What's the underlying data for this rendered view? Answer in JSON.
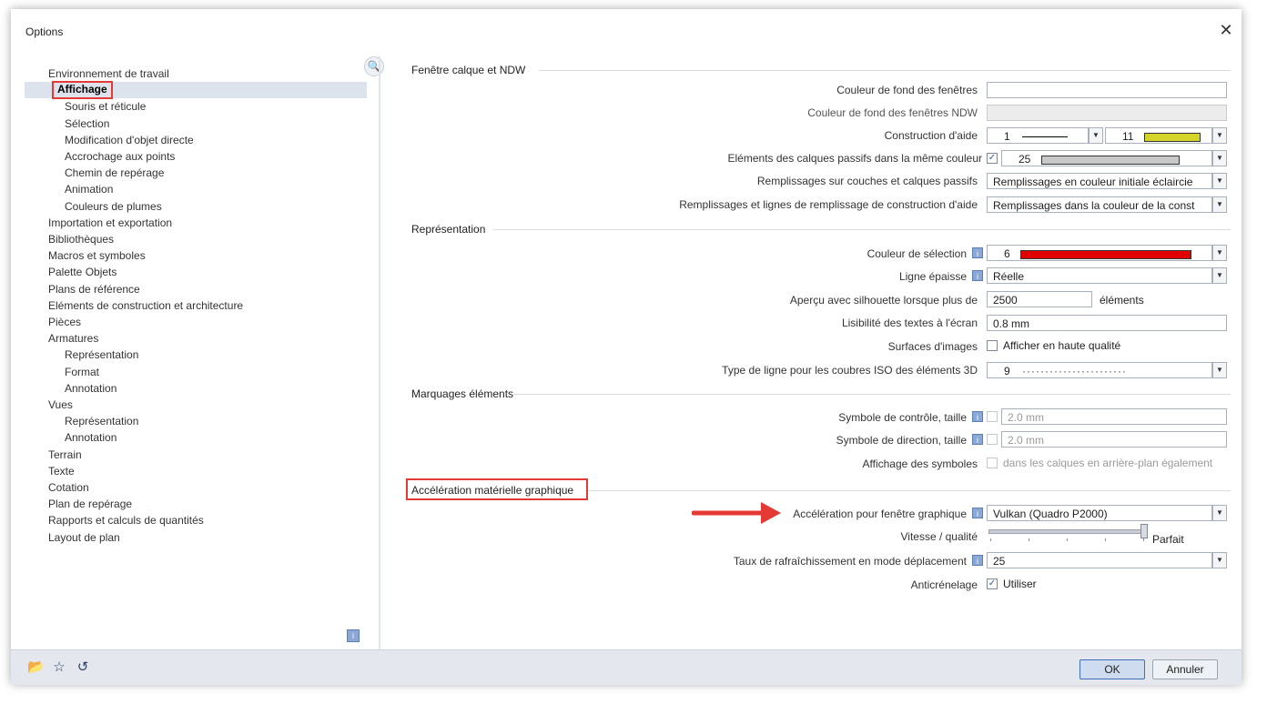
{
  "window": {
    "title": "Options",
    "close_symbol": "✕"
  },
  "tree": {
    "items": [
      {
        "label": "Environnement de travail",
        "level": 0
      },
      {
        "label": "Affichage",
        "level": 1,
        "selected": true
      },
      {
        "label": "Souris et réticule",
        "level": 1
      },
      {
        "label": "Sélection",
        "level": 1
      },
      {
        "label": "Modification d'objet directe",
        "level": 1
      },
      {
        "label": "Accrochage aux points",
        "level": 1
      },
      {
        "label": "Chemin de repérage",
        "level": 1
      },
      {
        "label": "Animation",
        "level": 1
      },
      {
        "label": "Couleurs de plumes",
        "level": 1
      },
      {
        "label": "Importation et exportation",
        "level": 0
      },
      {
        "label": "Bibliothèques",
        "level": 0
      },
      {
        "label": "Macros et symboles",
        "level": 0
      },
      {
        "label": "Palette Objets",
        "level": 0
      },
      {
        "label": "Plans de référence",
        "level": 0
      },
      {
        "label": "Eléments de construction et architecture",
        "level": 0
      },
      {
        "label": "Pièces",
        "level": 0
      },
      {
        "label": "Armatures",
        "level": 0
      },
      {
        "label": "Représentation",
        "level": 1
      },
      {
        "label": "Format",
        "level": 1
      },
      {
        "label": "Annotation",
        "level": 1
      },
      {
        "label": "Vues",
        "level": 0
      },
      {
        "label": "Représentation",
        "level": 1
      },
      {
        "label": "Annotation",
        "level": 1
      },
      {
        "label": "Terrain",
        "level": 0
      },
      {
        "label": "Texte",
        "level": 0
      },
      {
        "label": "Cotation",
        "level": 0
      },
      {
        "label": "Plan de repérage",
        "level": 0
      },
      {
        "label": "Rapports et calculs de quantités",
        "level": 0
      },
      {
        "label": "Layout de plan",
        "level": 0
      }
    ]
  },
  "sections": {
    "s1": "Fenêtre calque et NDW",
    "s2": "Représentation",
    "s3": "Marquages éléments",
    "s4": "Accélération matérielle graphique"
  },
  "rows": {
    "bg_color": {
      "label": "Couleur de fond des fenêtres"
    },
    "bg_color_ndw": {
      "label": "Couleur de fond des fenêtres NDW"
    },
    "construction": {
      "label": "Construction d'aide",
      "pen": "1",
      "color_num": "11",
      "color": "#d4d42a"
    },
    "passive_layers": {
      "label": "Eléments des calques passifs dans la même couleur",
      "color_num": "25",
      "color": "#c8c8c8"
    },
    "passive_fills": {
      "label": "Remplissages sur couches et calques passifs",
      "value": "Remplissages en couleur initiale éclaircie"
    },
    "aux_fills": {
      "label": "Remplissages et lignes de remplissage de construction d'aide",
      "value": "Remplissages dans la couleur de la const"
    },
    "sel_color": {
      "label": "Couleur de sélection",
      "color_num": "6",
      "color": "#e00000"
    },
    "thick_line": {
      "label": "Ligne épaisse",
      "value": "Réelle"
    },
    "silhouette": {
      "label": "Aperçu avec silhouette lorsque plus de",
      "value": "2500",
      "unit": "éléments"
    },
    "text_legibility": {
      "label": "Lisibilité des textes à l'écran",
      "value": "0.8 mm"
    },
    "image_surfaces": {
      "label": "Surfaces d'images",
      "check_label": "Afficher en haute qualité"
    },
    "iso_linetype": {
      "label": "Type de ligne pour les coubres ISO des éléments 3D",
      "value": "9",
      "dots": "·······················"
    },
    "ctrl_symbol": {
      "label": "Symbole de contrôle, taille",
      "value": "2.0 mm"
    },
    "dir_symbol": {
      "label": "Symbole de direction, taille",
      "value": "2.0 mm"
    },
    "sym_display": {
      "label": "Affichage des symboles",
      "check_label": "dans les calques en arrière-plan également"
    },
    "accel": {
      "label": "Accélération pour fenêtre graphique",
      "value": "Vulkan (Quadro P2000)"
    },
    "speed": {
      "label": "Vitesse / qualité",
      "end_label": "Parfait",
      "level": 1.0
    },
    "refresh": {
      "label": "Taux de rafraîchissement en mode déplacement",
      "value": "25"
    },
    "antialias": {
      "label": "Anticrénelage",
      "check_label": "Utiliser"
    }
  },
  "buttons": {
    "ok": "OK",
    "cancel": "Annuler"
  },
  "icons": {
    "search": "search-icon",
    "info": "info-icon"
  },
  "colors": {
    "highlight": "#e53935",
    "arrow": "#e53935"
  }
}
